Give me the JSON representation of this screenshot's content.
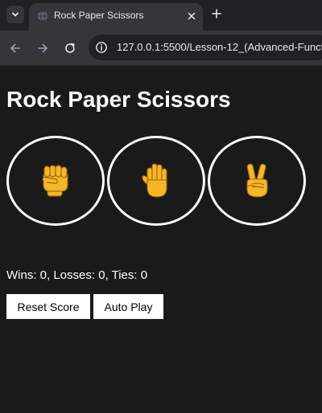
{
  "browser": {
    "tab": {
      "title": "Rock Paper Scissors"
    },
    "address_bar": {
      "url": "127.0.0.1:5500/Lesson-12_(Advanced-Functio"
    }
  },
  "page": {
    "title": "Rock Paper Scissors",
    "choices": [
      {
        "name": "rock",
        "icon": "raised-fist-icon"
      },
      {
        "name": "paper",
        "icon": "raised-hand-icon"
      },
      {
        "name": "scissors",
        "icon": "victory-hand-icon"
      }
    ],
    "score_text": "Wins: 0, Losses: 0, Ties: 0",
    "reset_label": "Reset Score",
    "auto_play_label": "Auto Play"
  },
  "colors": {
    "page_background": "#1a1a1a",
    "skin": "#f5b72a",
    "skin_outline": "#a3670b"
  }
}
